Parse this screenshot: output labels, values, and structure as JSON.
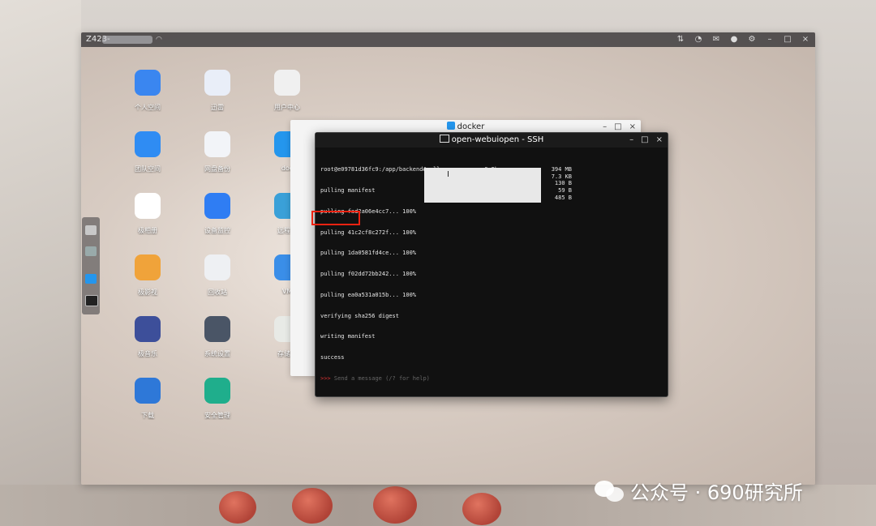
{
  "nas": {
    "title": "Z423-",
    "desktop_icons": [
      {
        "label": "个人空间",
        "icon": "folder-icon",
        "color": "#3a86f0"
      },
      {
        "label": "迅雷",
        "icon": "thunder-icon",
        "color": "#e9eef8"
      },
      {
        "label": "用户中心",
        "icon": "user-avatar-icon",
        "color": "#f0f0f0"
      },
      {
        "label": "团队空间",
        "icon": "team-folder-icon",
        "color": "#2f8cf3"
      },
      {
        "label": "网盘备份",
        "icon": "cloud-backup-icon",
        "color": "#f2f4f8"
      },
      {
        "label": "doc",
        "icon": "docker-icon",
        "color": "#2496ed"
      },
      {
        "label": "极相册",
        "icon": "photos-icon",
        "color": "#ffffff"
      },
      {
        "label": "设备监控",
        "icon": "monitor-chart-icon",
        "color": "#2f7df3"
      },
      {
        "label": "远程访",
        "icon": "remote-icon",
        "color": "#3aa0d8"
      },
      {
        "label": "极影视",
        "icon": "video-icon",
        "color": "#f0a33a"
      },
      {
        "label": "回收站",
        "icon": "trash-icon",
        "color": "#eef0f3"
      },
      {
        "label": "VM",
        "icon": "vm-icon",
        "color": "#3a8ee8"
      },
      {
        "label": "极音乐",
        "icon": "music-icon",
        "color": "#3d4f9a"
      },
      {
        "label": "系统设置",
        "icon": "settings-icon",
        "color": "#4a5566"
      },
      {
        "label": "存储管",
        "icon": "storage-icon",
        "color": "#e8eae6"
      },
      {
        "label": "下载",
        "icon": "download-icon",
        "color": "#2e78d8"
      },
      {
        "label": "安全管理",
        "icon": "shield-plus-icon",
        "color": "#1fae8c"
      }
    ]
  },
  "docker_window": {
    "title": "docker"
  },
  "ssh_window": {
    "title": "open-webuiopen - SSH",
    "lines": [
      "root@e09781d36fc9:/app/backend# ollama run qwen:0.5b",
      "pulling manifest",
      "pulling fad2a06e4cc7... 100%",
      "pulling 41c2cf8c272f... 100%",
      "pulling 1da0581fd4ce... 100%",
      "pulling f02dd72bb242... 100%",
      "pulling ea0a531a015b... 100%",
      "verifying sha256 digest",
      "writing manifest",
      "success"
    ],
    "sizes": [
      "394 MB",
      "7.3 KB",
      "130 B",
      "59 B",
      "485 B"
    ],
    "prompt_symbol": ">>>",
    "prompt_hint": "Send a message (/? for help)"
  },
  "watermark": {
    "text": "公众号 · 690研究所"
  }
}
